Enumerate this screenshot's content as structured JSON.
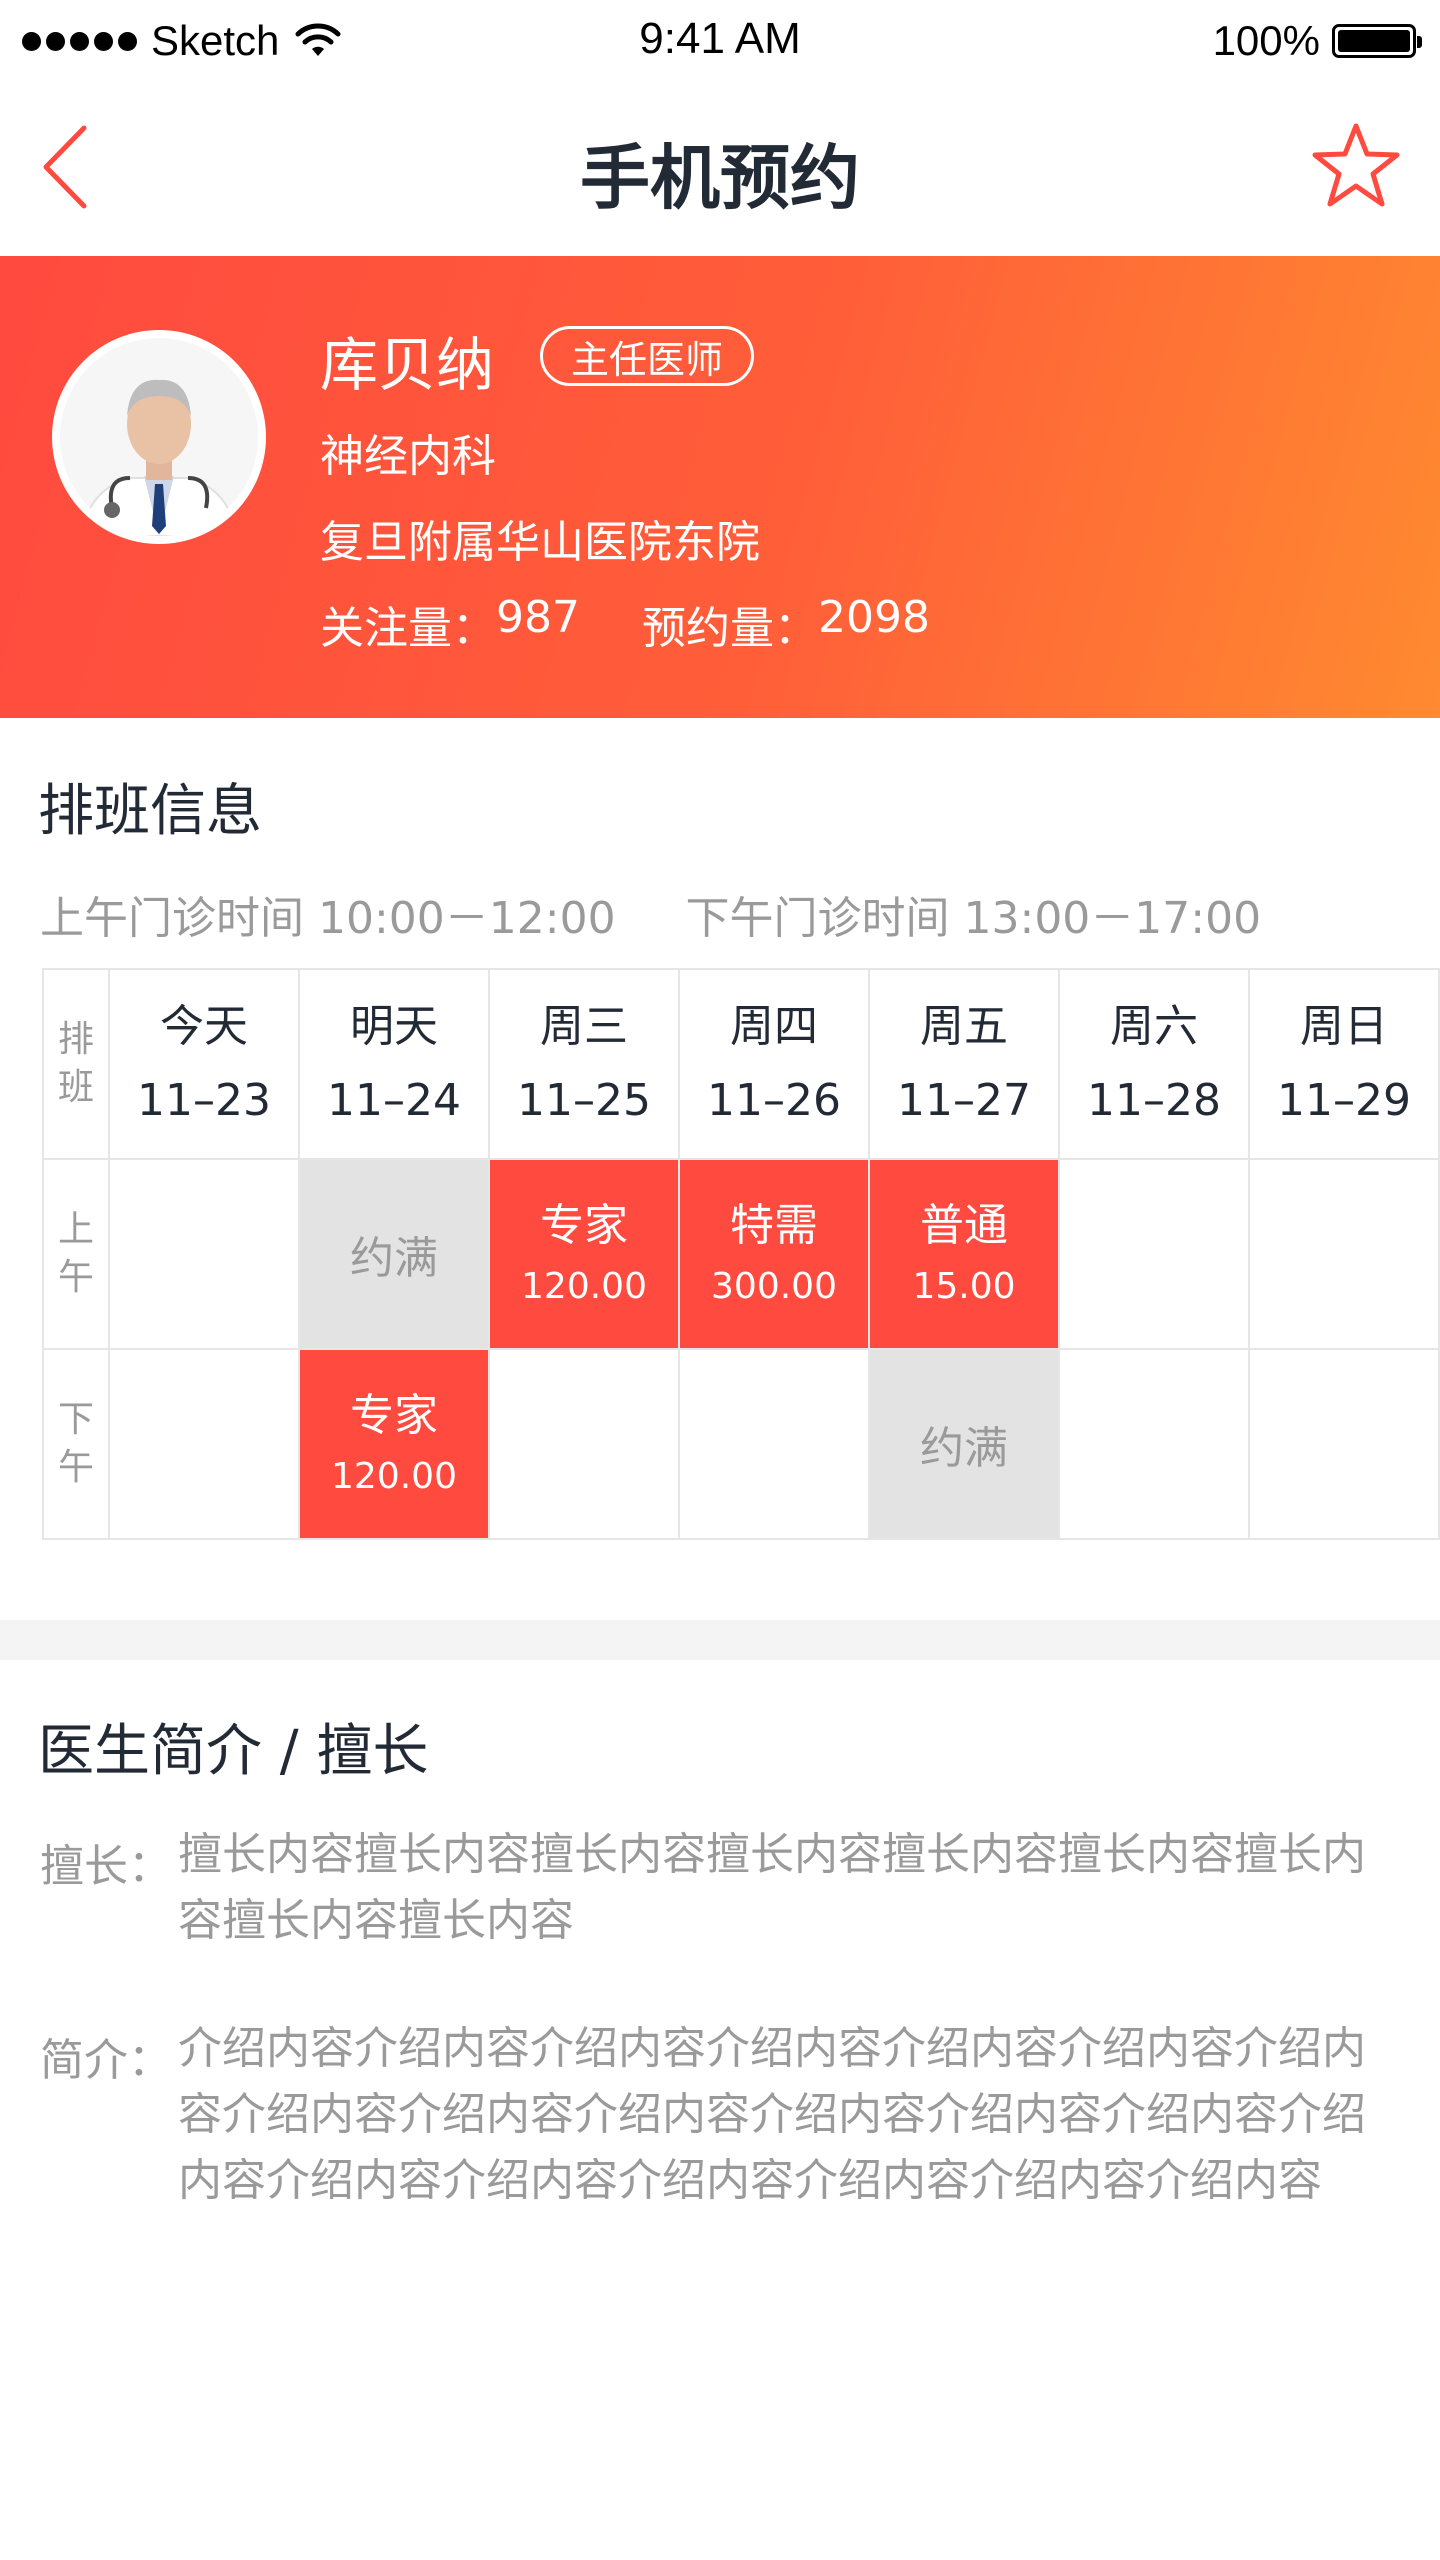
{
  "status_bar": {
    "carrier": "Sketch",
    "time": "9:41 AM",
    "battery": "100%"
  },
  "nav": {
    "title": "手机预约"
  },
  "doctor": {
    "name": "库贝纳",
    "title_badge": "主任医师",
    "department": "神经内科",
    "hospital": "复旦附属华山医院东院",
    "followers_label": "关注量：",
    "followers": "987",
    "appointments_label": "预约量：",
    "appointments": "2098"
  },
  "schedule": {
    "title": "排班信息",
    "hours": "上午门诊时间 10:00－12:00     下午门诊时间 13:00－17:00",
    "corner": "排班",
    "am_label": "上午",
    "pm_label": "下午",
    "days": [
      {
        "weekday": "今天",
        "date": "11–23"
      },
      {
        "weekday": "明天",
        "date": "11–24"
      },
      {
        "weekday": "周三",
        "date": "11–25"
      },
      {
        "weekday": "周四",
        "date": "11–26"
      },
      {
        "weekday": "周五",
        "date": "11–27"
      },
      {
        "weekday": "周六",
        "date": "11–28"
      },
      {
        "weekday": "周日",
        "date": "11–29"
      }
    ],
    "am_slots": [
      {
        "state": "empty"
      },
      {
        "state": "full",
        "text": "约满"
      },
      {
        "state": "open",
        "type": "专家",
        "price": "120.00"
      },
      {
        "state": "open",
        "type": "特需",
        "price": "300.00"
      },
      {
        "state": "open",
        "type": "普通",
        "price": "15.00"
      },
      {
        "state": "empty"
      },
      {
        "state": "empty"
      }
    ],
    "pm_slots": [
      {
        "state": "empty"
      },
      {
        "state": "open",
        "type": "专家",
        "price": "120.00"
      },
      {
        "state": "empty"
      },
      {
        "state": "empty"
      },
      {
        "state": "full",
        "text": "约满"
      },
      {
        "state": "empty"
      },
      {
        "state": "empty"
      }
    ]
  },
  "intro": {
    "title": "医生简介 / 擅长",
    "specialty_label": "擅长：",
    "specialty_text": "擅长内容擅长内容擅长内容擅长内容擅长内容擅长内容擅长内容擅长内容擅长内容",
    "bio_label": "简介：",
    "bio_text": "介绍内容介绍内容介绍内容介绍内容介绍内容介绍内容介绍内容介绍内容介绍内容介绍内容介绍内容介绍内容介绍内容介绍内容介绍内容介绍内容介绍内容介绍内容介绍内容介绍内容"
  },
  "colors": {
    "accent": "#ff4a3f",
    "accent_end": "#ff8a30",
    "full_bg": "#e3e3e3"
  },
  "icons": {
    "back": "chevron-left-icon",
    "favorite": "star-outline-icon",
    "wifi": "wifi-icon",
    "battery": "battery-icon"
  }
}
